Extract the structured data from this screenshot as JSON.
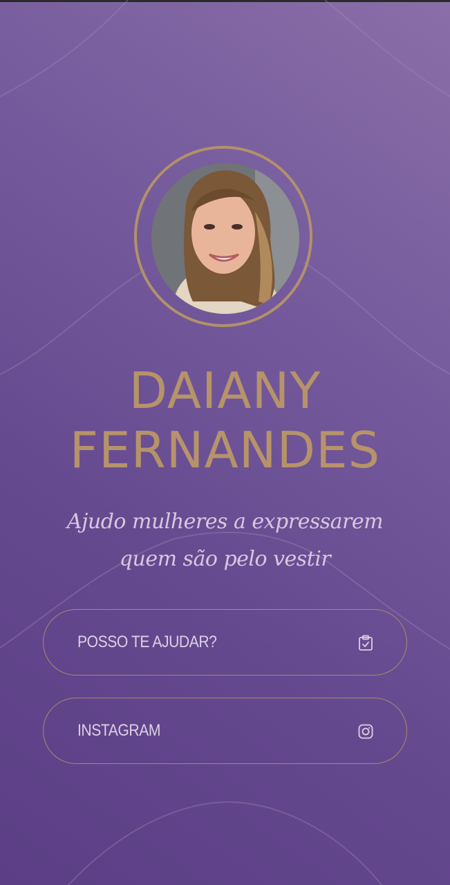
{
  "profile": {
    "first_name": "DAIANY",
    "last_name": "FERNANDES",
    "tagline": "Ajudo mulheres a expressarem quem são pelo vestir",
    "avatar_alt": "Foto de perfil"
  },
  "links": [
    {
      "label": "POSSO TE AJUDAR?",
      "icon": "clipboard-check-icon"
    },
    {
      "label": "INSTAGRAM",
      "icon": "instagram-icon"
    }
  ],
  "colors": {
    "accent": "#b7936a",
    "background_top": "#8a6ea8",
    "background_bottom": "#5b3e85"
  }
}
